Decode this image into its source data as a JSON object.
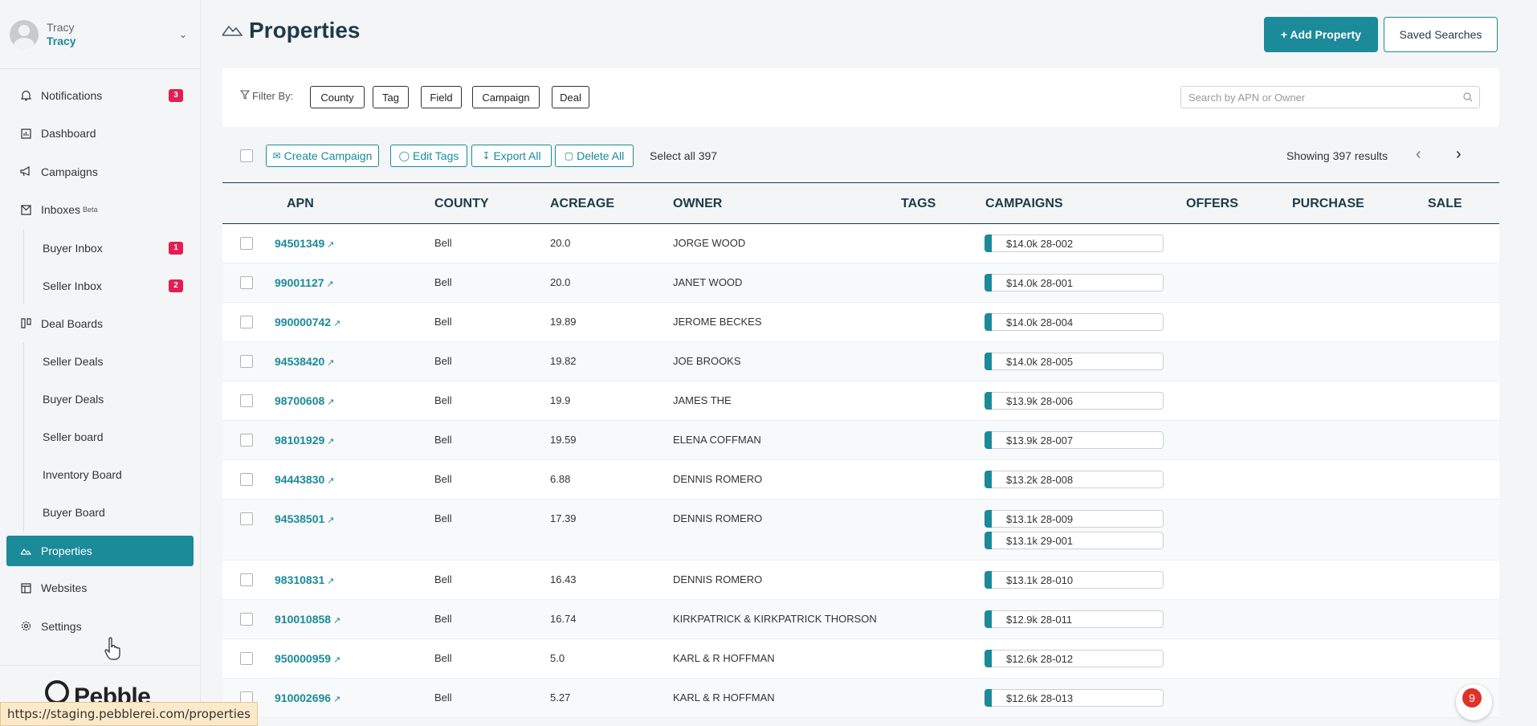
{
  "user": {
    "name_top": "Tracy",
    "name_bottom": "Tracy"
  },
  "sidebar": {
    "items": [
      {
        "label": "Notifications",
        "badge": "3"
      },
      {
        "label": "Dashboard"
      },
      {
        "label": "Campaigns"
      },
      {
        "label": "Inboxes",
        "beta": "Beta"
      },
      {
        "label": "Buyer Inbox",
        "badge": "1"
      },
      {
        "label": "Seller Inbox",
        "badge": "2"
      },
      {
        "label": "Deal Boards"
      },
      {
        "label": "Seller Deals"
      },
      {
        "label": "Buyer Deals"
      },
      {
        "label": "Seller board"
      },
      {
        "label": "Inventory Board"
      },
      {
        "label": "Buyer Board"
      },
      {
        "label": "Properties"
      },
      {
        "label": "Websites"
      },
      {
        "label": "Settings"
      }
    ],
    "logo": "Pebble"
  },
  "header": {
    "title": "Properties",
    "add_button": "+ Add Property",
    "saved_button": "Saved Searches"
  },
  "filters": {
    "label": "Filter By:",
    "chips": [
      "County",
      "Tag",
      "Field",
      "Campaign",
      "Deal"
    ],
    "search_placeholder": "Search by APN or Owner"
  },
  "toolbar": {
    "create_campaign": "Create Campaign",
    "edit_tags": "Edit Tags",
    "export_all": "Export All",
    "delete_all": "Delete All",
    "select_all": "Select all 397",
    "showing": "Showing 397 results"
  },
  "table": {
    "columns": [
      "APN",
      "COUNTY",
      "ACREAGE",
      "OWNER",
      "TAGS",
      "CAMPAIGNS",
      "OFFERS",
      "PURCHASE",
      "SALE"
    ],
    "rows": [
      {
        "apn": "94501349",
        "county": "Bell",
        "acreage": "20.0",
        "owner": "JORGE WOOD",
        "campaigns": [
          "$14.0k 28-002"
        ]
      },
      {
        "apn": "99001127",
        "county": "Bell",
        "acreage": "20.0",
        "owner": "JANET WOOD",
        "campaigns": [
          "$14.0k 28-001"
        ]
      },
      {
        "apn": "990000742",
        "county": "Bell",
        "acreage": "19.89",
        "owner": "JEROME BECKES",
        "campaigns": [
          "$14.0k 28-004"
        ]
      },
      {
        "apn": "94538420",
        "county": "Bell",
        "acreage": "19.82",
        "owner": "JOE BROOKS",
        "campaigns": [
          "$14.0k 28-005"
        ]
      },
      {
        "apn": "98700608",
        "county": "Bell",
        "acreage": "19.9",
        "owner": "JAMES THE",
        "campaigns": [
          "$13.9k 28-006"
        ]
      },
      {
        "apn": "98101929",
        "county": "Bell",
        "acreage": "19.59",
        "owner": "ELENA COFFMAN",
        "campaigns": [
          "$13.9k 28-007"
        ]
      },
      {
        "apn": "94443830",
        "county": "Bell",
        "acreage": "6.88",
        "owner": "DENNIS ROMERO",
        "campaigns": [
          "$13.2k 28-008"
        ]
      },
      {
        "apn": "94538501",
        "county": "Bell",
        "acreage": "17.39",
        "owner": "DENNIS ROMERO",
        "campaigns": [
          "$13.1k 28-009",
          "$13.1k 29-001"
        ]
      },
      {
        "apn": "98310831",
        "county": "Bell",
        "acreage": "16.43",
        "owner": "DENNIS ROMERO",
        "campaigns": [
          "$13.1k 28-010"
        ]
      },
      {
        "apn": "910010858",
        "county": "Bell",
        "acreage": "16.74",
        "owner": "KIRKPATRICK & KIRKPATRICK THORSON",
        "campaigns": [
          "$12.9k 28-011"
        ]
      },
      {
        "apn": "950000959",
        "county": "Bell",
        "acreage": "5.0",
        "owner": "KARL & R HOFFMAN",
        "campaigns": [
          "$12.6k 28-012"
        ]
      },
      {
        "apn": "910002696",
        "county": "Bell",
        "acreage": "5.27",
        "owner": "KARL & R HOFFMAN",
        "campaigns": [
          "$12.6k 28-013"
        ]
      }
    ]
  },
  "statusbar": {
    "url": "https://staging.pebblerei.com/properties"
  },
  "help": {
    "count": "9"
  },
  "colors": {
    "accent": "#1b8a99",
    "badge": "#e41e54",
    "heading": "#1e3a4a"
  }
}
